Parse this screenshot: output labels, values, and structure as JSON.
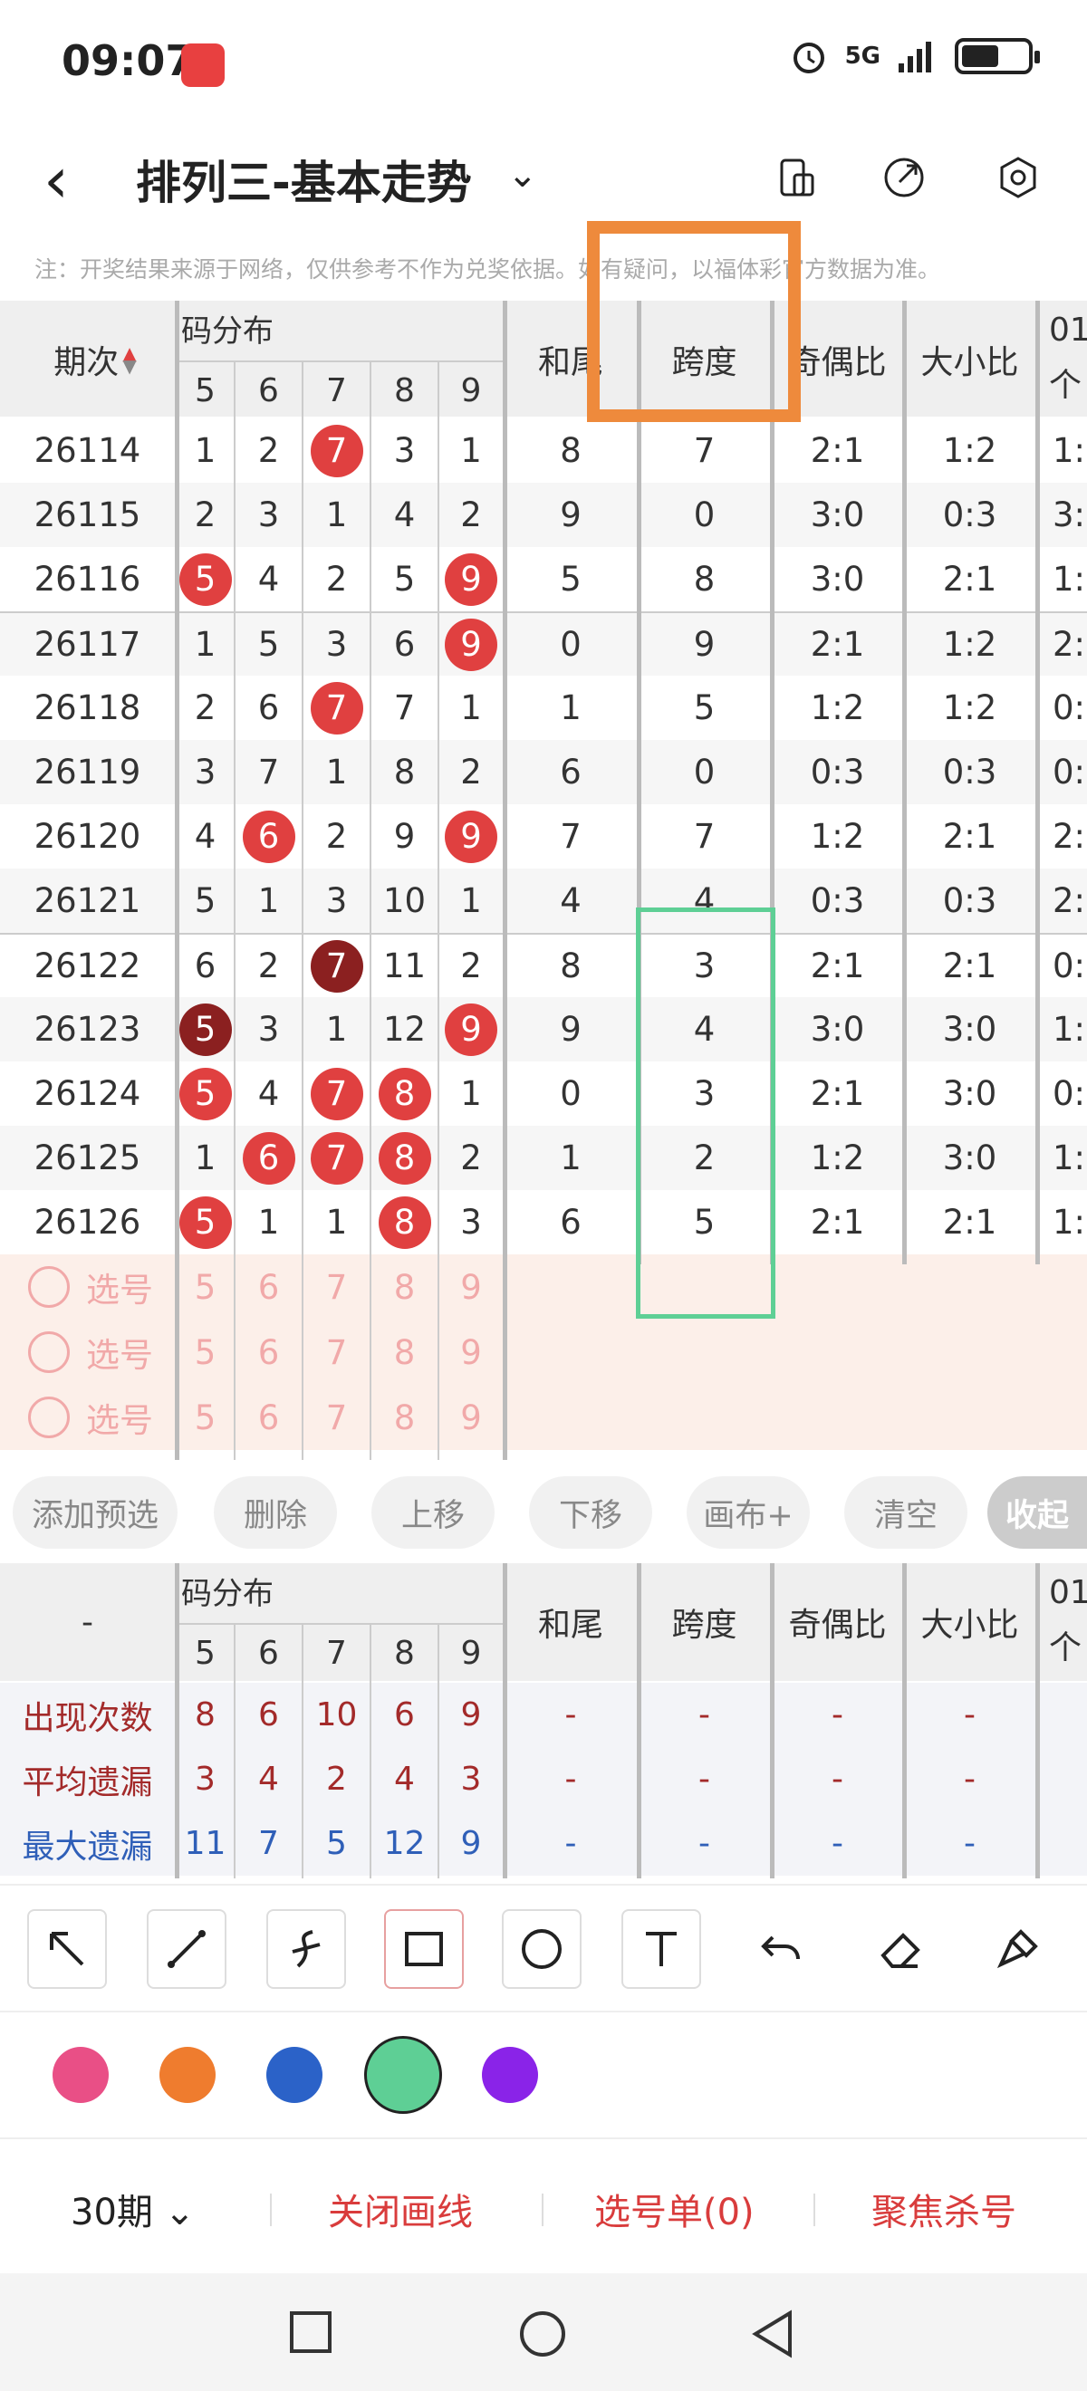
{
  "status": {
    "time": "09:07",
    "network": "5G"
  },
  "nav": {
    "title": "排列三-基本走势"
  },
  "note": "注：开奖结果来源于网络，仅供参考不作为兑奖依据。如有疑问，以福体彩官方数据为准。",
  "header": {
    "issue": "期次",
    "dist": "码分布",
    "digits": [
      "5",
      "6",
      "7",
      "8",
      "9"
    ],
    "hewei": "和尾",
    "kuadu": "跨度",
    "jiou": "奇偶比",
    "daxiao": "大小比",
    "extra1": "01",
    "extra2": "个"
  },
  "rows": [
    {
      "issue": "26114",
      "d": [
        "1",
        "2",
        "7",
        "3",
        "1"
      ],
      "hewei": "8",
      "kuadu": "7",
      "jiou": "2:1",
      "daxiao": "1:2",
      "extra": "1:"
    },
    {
      "issue": "26115",
      "d": [
        "2",
        "3",
        "1",
        "4",
        "2"
      ],
      "hewei": "9",
      "kuadu": "0",
      "jiou": "3:0",
      "daxiao": "0:3",
      "extra": "3:"
    },
    {
      "issue": "26116",
      "d": [
        "5",
        "4",
        "2",
        "5",
        "9"
      ],
      "hewei": "5",
      "kuadu": "8",
      "jiou": "3:0",
      "daxiao": "2:1",
      "extra": "1:"
    },
    {
      "issue": "26117",
      "d": [
        "1",
        "5",
        "3",
        "6",
        "9"
      ],
      "hewei": "0",
      "kuadu": "9",
      "jiou": "2:1",
      "daxiao": "1:2",
      "extra": "2:"
    },
    {
      "issue": "26118",
      "d": [
        "2",
        "6",
        "7",
        "7",
        "1"
      ],
      "hewei": "1",
      "kuadu": "5",
      "jiou": "1:2",
      "daxiao": "1:2",
      "extra": "0:"
    },
    {
      "issue": "26119",
      "d": [
        "3",
        "7",
        "1",
        "8",
        "2"
      ],
      "hewei": "6",
      "kuadu": "0",
      "jiou": "0:3",
      "daxiao": "0:3",
      "extra": "0:"
    },
    {
      "issue": "26120",
      "d": [
        "4",
        "6",
        "2",
        "9",
        "9"
      ],
      "hewei": "7",
      "kuadu": "7",
      "jiou": "1:2",
      "daxiao": "2:1",
      "extra": "2:"
    },
    {
      "issue": "26121",
      "d": [
        "5",
        "1",
        "3",
        "10",
        "1"
      ],
      "hewei": "4",
      "kuadu": "4",
      "jiou": "0:3",
      "daxiao": "0:3",
      "extra": "2:"
    },
    {
      "issue": "26122",
      "d": [
        "6",
        "2",
        "7",
        "11",
        "2"
      ],
      "hewei": "8",
      "kuadu": "3",
      "jiou": "2:1",
      "daxiao": "2:1",
      "extra": "0:"
    },
    {
      "issue": "26123",
      "d": [
        "5",
        "3",
        "1",
        "12",
        "9"
      ],
      "hewei": "9",
      "kuadu": "4",
      "jiou": "3:0",
      "daxiao": "3:0",
      "extra": "1:"
    },
    {
      "issue": "26124",
      "d": [
        "5",
        "4",
        "7",
        "8",
        "1"
      ],
      "hewei": "0",
      "kuadu": "3",
      "jiou": "2:1",
      "daxiao": "3:0",
      "extra": "0:"
    },
    {
      "issue": "26125",
      "d": [
        "1",
        "6",
        "7",
        "8",
        "2"
      ],
      "hewei": "1",
      "kuadu": "2",
      "jiou": "1:2",
      "daxiao": "3:0",
      "extra": "1:"
    },
    {
      "issue": "26126",
      "d": [
        "5",
        "1",
        "1",
        "8",
        "3"
      ],
      "hewei": "6",
      "kuadu": "5",
      "jiou": "2:1",
      "daxiao": "2:1",
      "extra": "1:"
    }
  ],
  "pick": {
    "label": "选号",
    "digits": [
      "5",
      "6",
      "7",
      "8",
      "9"
    ]
  },
  "actions": [
    "添加预选",
    "删除",
    "上移",
    "下移",
    "画布+",
    "清空",
    "收起"
  ],
  "stats": {
    "dash": "-",
    "rows": [
      {
        "label": "出现次数",
        "vals": [
          "8",
          "6",
          "10",
          "6",
          "9"
        ],
        "color": "#a32a2a"
      },
      {
        "label": "平均遗漏",
        "vals": [
          "3",
          "4",
          "2",
          "4",
          "3"
        ],
        "color": "#a32a2a"
      },
      {
        "label": "最大遗漏",
        "vals": [
          "11",
          "7",
          "5",
          "12",
          "9"
        ],
        "color": "#2f5fb8"
      }
    ]
  },
  "colors": [
    "#e94f86",
    "#ef7c2e",
    "#2b62c8",
    "#5ecf95",
    "#8a23e8"
  ],
  "bottom": {
    "period": "30期",
    "close": "关闭画线",
    "list": "选号单(0)",
    "focus": "聚焦杀号"
  }
}
